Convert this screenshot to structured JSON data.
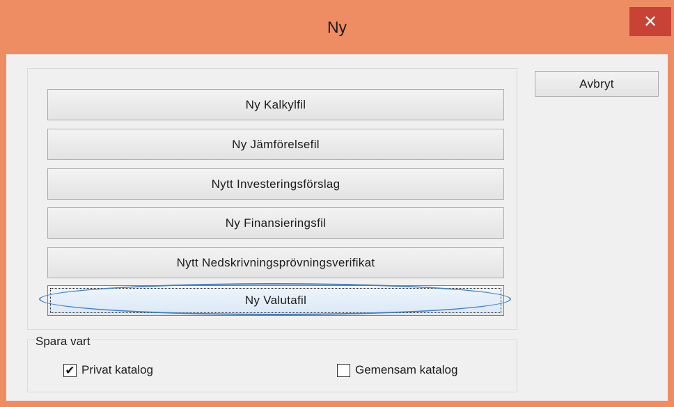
{
  "window": {
    "title": "Ny",
    "close_label": "✕"
  },
  "actions": {
    "cancel_label": "Avbryt"
  },
  "new_buttons": [
    {
      "label": "Ny Kalkylfil"
    },
    {
      "label": "Ny Jämförelsefil"
    },
    {
      "label": "Nytt Investeringsförslag"
    },
    {
      "label": "Ny Finansieringsfil"
    },
    {
      "label": "Nytt Nedskrivningsprövningsverifikat"
    },
    {
      "label": "Ny Valutafil",
      "focused": true,
      "highlighted": true
    }
  ],
  "save_location": {
    "group_label": "Spara vart",
    "options": [
      {
        "label": "Privat katalog",
        "checked": true
      },
      {
        "label": "Gemensam katalog",
        "checked": false
      }
    ]
  },
  "colors": {
    "titlebar": "#ee8d63",
    "close_button": "#c84235",
    "highlight": "#3d7fd0"
  }
}
